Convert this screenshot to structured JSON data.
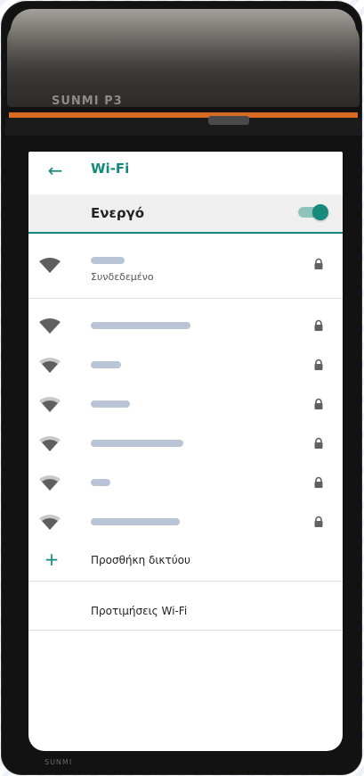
{
  "device": {
    "brand": "SUNMI P3",
    "bezel_brand": "SUNMI"
  },
  "appbar": {
    "back_icon": "arrow-left-icon",
    "title": "Wi-Fi"
  },
  "wifi_toggle": {
    "label": "Ενεργό",
    "enabled": true
  },
  "connected_network": {
    "status": "Συνδεδεμένο",
    "secured": true
  },
  "networks": [
    {
      "secured": true
    },
    {
      "secured": true
    },
    {
      "secured": true
    },
    {
      "secured": true
    },
    {
      "secured": true
    },
    {
      "secured": true
    }
  ],
  "actions": {
    "add_network": "Προσθήκη δικτύου",
    "preferences": "Προτιμήσεις Wi-Fi"
  },
  "colors": {
    "accent": "#14897a",
    "toggle_track": "#8fc4bc",
    "icon": "#616161"
  }
}
